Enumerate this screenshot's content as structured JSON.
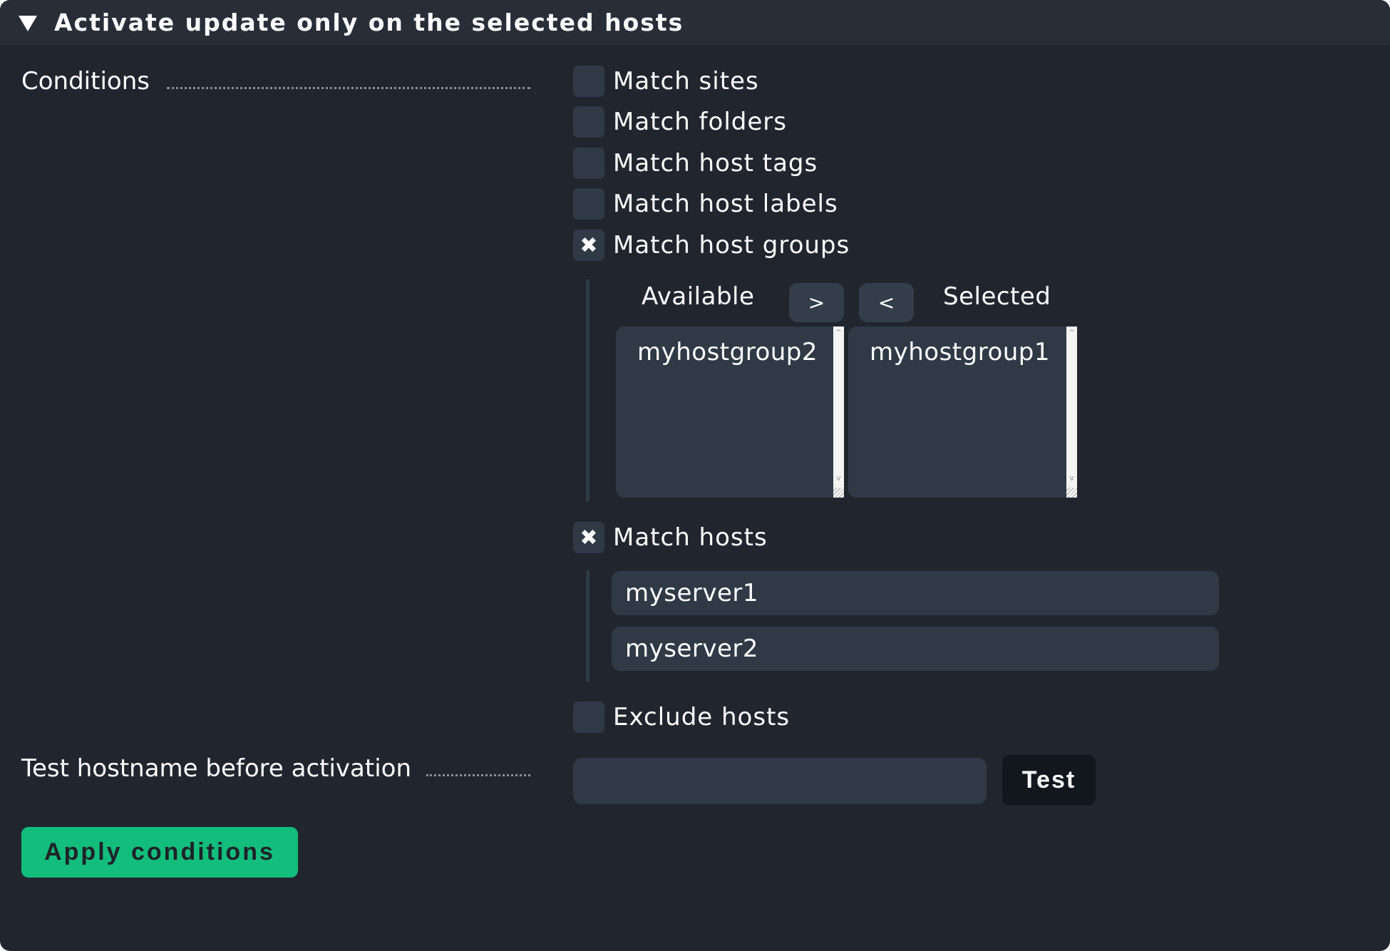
{
  "header": {
    "title": "Activate update only on the selected hosts",
    "toggle_icon": "triangle-down-icon"
  },
  "conditions": {
    "label": "Conditions",
    "options": [
      {
        "label": "Match sites",
        "checked": false
      },
      {
        "label": "Match folders",
        "checked": false
      },
      {
        "label": "Match host tags",
        "checked": false
      },
      {
        "label": "Match host labels",
        "checked": false
      },
      {
        "label": "Match host groups",
        "checked": true
      },
      {
        "label": "Match hosts",
        "checked": true
      },
      {
        "label": "Exclude hosts",
        "checked": false
      }
    ],
    "check_mark": "✖",
    "host_groups": {
      "available_label": "Available",
      "selected_label": "Selected",
      "add_button": ">",
      "remove_button": "<",
      "available": [
        "myhostgroup2"
      ],
      "selected": [
        "myhostgroup1"
      ]
    },
    "hosts": [
      "myserver1",
      "myserver2"
    ]
  },
  "test": {
    "label": "Test hostname before activation",
    "input_value": "",
    "button_label": "Test"
  },
  "apply_button": "Apply conditions",
  "colors": {
    "background": "#21262e",
    "header": "#282e38",
    "field": "#303946",
    "accent_green": "#13bd7b",
    "dark_button": "#12171e"
  }
}
